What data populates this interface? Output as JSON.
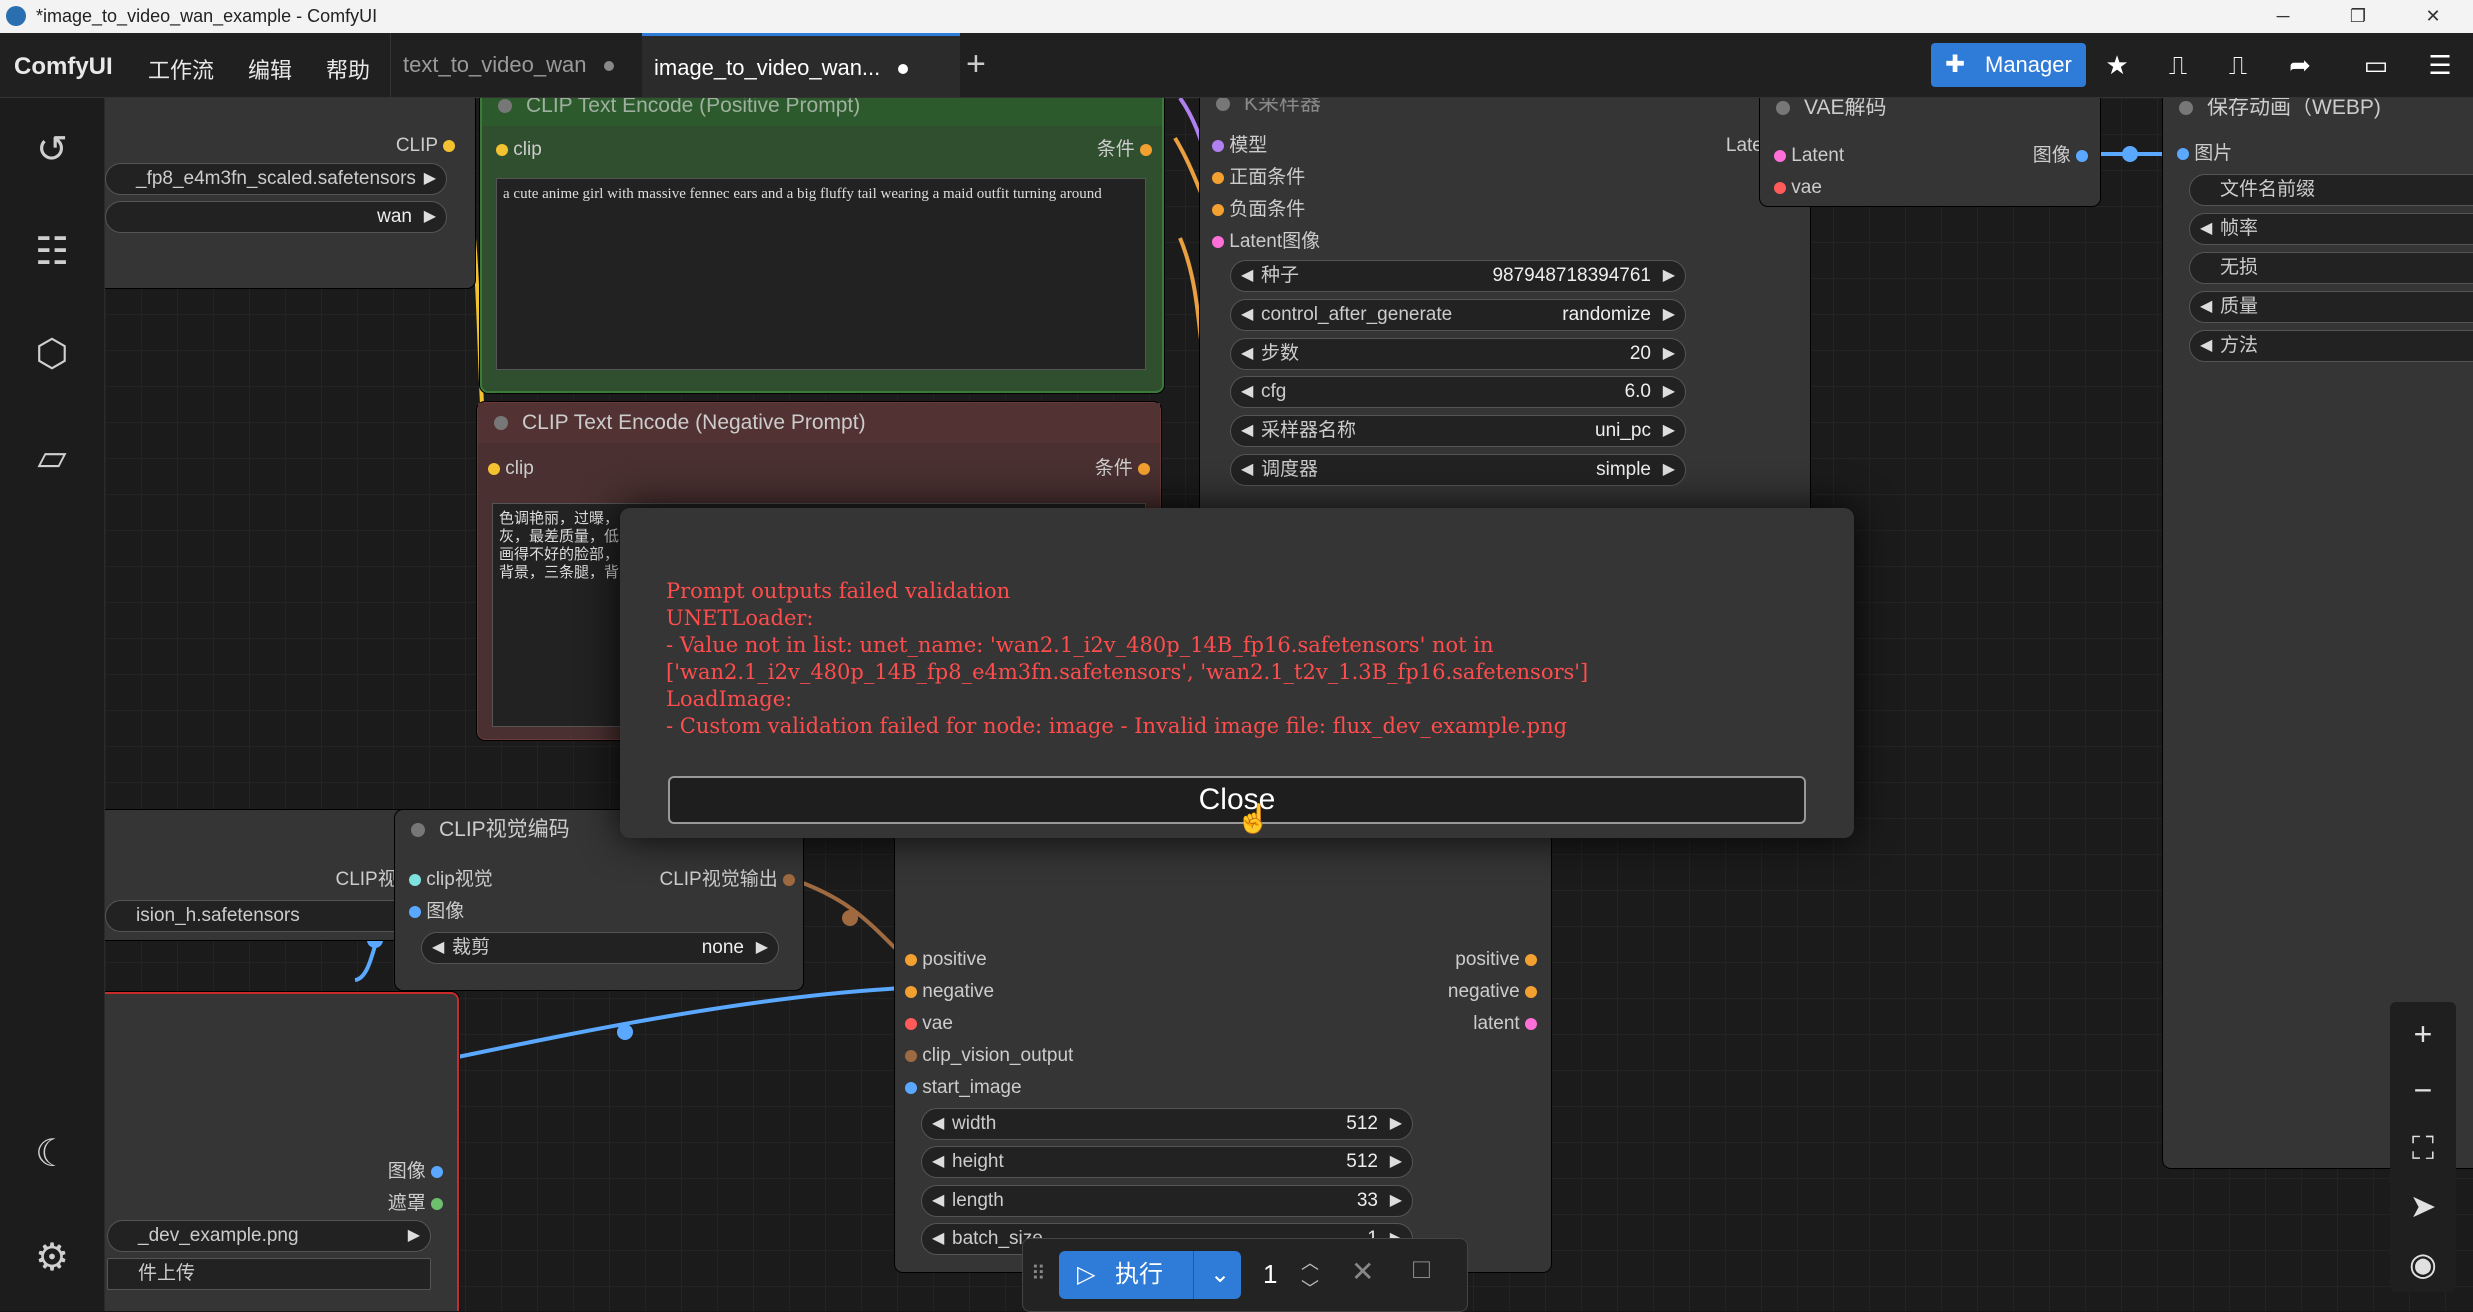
{
  "window": {
    "title": "*image_to_video_wan_example - ComfyUI",
    "min": "─",
    "restore": "❐",
    "close": "✕"
  },
  "menubar": {
    "logo": "ComfyUI",
    "menus": [
      "工作流",
      "编辑",
      "帮助"
    ],
    "tabs": [
      {
        "label": "text_to_video_wan",
        "active": false
      },
      {
        "label": "image_to_video_wan...",
        "active": true
      }
    ],
    "new_tab": "+",
    "manager_label": "Manager",
    "icons": [
      "star-icon",
      "queue-icon",
      "queue-alt-icon",
      "share-icon",
      "panel-icon",
      "menu-icon"
    ]
  },
  "sidebar": {
    "icons": [
      "history-icon",
      "queue-list-icon",
      "model-library-icon",
      "workflows-folder-icon",
      "theme-moon-icon",
      "settings-gear-icon"
    ]
  },
  "nodes": {
    "loader_top": {
      "clip_out": "CLIP",
      "w1": "_fp8_e4m3fn_scaled.safetensors",
      "w2": "wan"
    },
    "clip_pos": {
      "title": "CLIP Text Encode (Positive Prompt)",
      "in": "clip",
      "out": "条件",
      "text": "a cute anime girl with massive fennec ears and a big fluffy tail wearing a maid outfit turning around"
    },
    "clip_neg": {
      "title": "CLIP Text Encode (Negative Prompt)",
      "in": "clip",
      "out": "条件",
      "text": "色调艳丽，过曝，\n灰，最差质量，低\n画得不好的脸部，\n背景，三条腿，背"
    },
    "ksampler": {
      "title": "K采样器",
      "inputs": [
        "模型",
        "正面条件",
        "负面条件",
        "Latent图像"
      ],
      "output": "Latent",
      "widgets": [
        {
          "label": "种子",
          "value": "987948718394761"
        },
        {
          "label": "control_after_generate",
          "value": "randomize"
        },
        {
          "label": "步数",
          "value": "20"
        },
        {
          "label": "cfg",
          "value": "6.0"
        },
        {
          "label": "采样器名称",
          "value": "uni_pc"
        },
        {
          "label": "调度器",
          "value": "simple"
        }
      ]
    },
    "vae_decode": {
      "title": "VAE解码",
      "in1": "Latent",
      "in2": "vae",
      "out": "图像"
    },
    "save": {
      "title": "保存动画（WEBP)",
      "in": "图片",
      "widgets": [
        "文件名前缀",
        "帧率",
        "无损",
        "质量",
        "方法"
      ]
    },
    "clip_vision_loader": {
      "out": "CLIP视觉",
      "w1": "ision_h.safetensors"
    },
    "clip_vision_encode": {
      "title": "CLIP视觉编码",
      "in1": "clip视觉",
      "in2": "图像",
      "out": "CLIP视觉输出",
      "crop_label": "裁剪",
      "crop_value": "none"
    },
    "load_image": {
      "out1": "图像",
      "out2": "遮罩",
      "file": "_dev_example.png",
      "upload": "件上传"
    },
    "wan_i2v": {
      "inputs": [
        "positive",
        "negative",
        "vae",
        "clip_vision_output",
        "start_image"
      ],
      "outputs": [
        "positive",
        "negative",
        "latent"
      ],
      "widgets": [
        {
          "label": "width",
          "value": "512"
        },
        {
          "label": "height",
          "value": "512"
        },
        {
          "label": "length",
          "value": "33"
        },
        {
          "label": "batch_size",
          "value": "1"
        }
      ]
    }
  },
  "modal": {
    "error_text": "Prompt outputs failed validation\nUNETLoader:\n- Value not in list: unet_name: 'wan2.1_i2v_480p_14B_fp16.safetensors' not in\n['wan2.1_i2v_480p_14B_fp8_e4m3fn.safetensors', 'wan2.1_t2v_1.3B_fp16.safetensors']\nLoadImage:\n- Custom validation failed for node: image - Invalid image file: flux_dev_example.png",
    "close_label": "Close"
  },
  "runbar": {
    "run_label": "执行",
    "batch_count": "1"
  },
  "zoom": [
    "zoom-in-icon",
    "zoom-out-icon",
    "fit-view-icon",
    "navigate-icon",
    "visibility-eye-icon"
  ]
}
